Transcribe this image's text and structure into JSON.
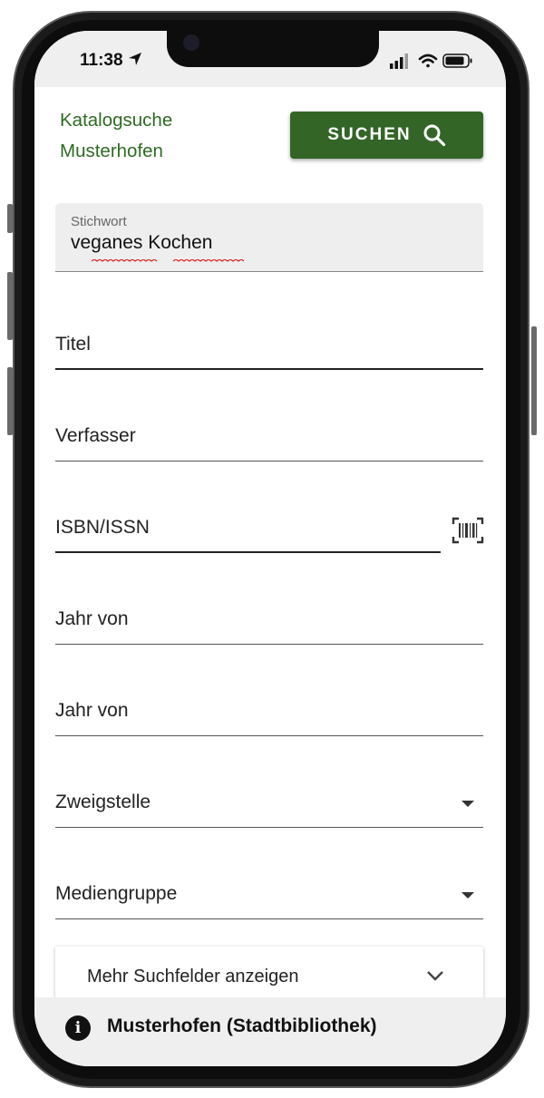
{
  "status_bar": {
    "time": "11:38"
  },
  "header": {
    "title_line1": "Katalogsuche",
    "title_line2": "Musterhofen",
    "search_button_label": "SUCHEN"
  },
  "form": {
    "keyword": {
      "label": "Stichwort",
      "value": "veganes Kochen"
    },
    "title_label": "Titel",
    "author_label": "Verfasser",
    "isbn_label": "ISBN/ISSN",
    "year_from_label": "Jahr von",
    "year_to_label": "Jahr von",
    "branch_label": "Zweigstelle",
    "media_group_label": "Mediengruppe",
    "more_fields_label": "Mehr Suchfelder anzeigen"
  },
  "footer": {
    "library_name": "Musterhofen (Stadtbibliothek)"
  },
  "colors": {
    "brand_green": "#336527",
    "title_green": "#2f6a24"
  }
}
